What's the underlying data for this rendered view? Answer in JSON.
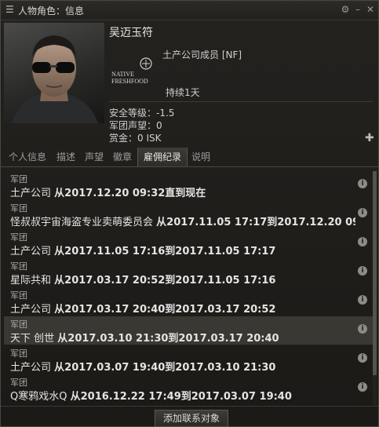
{
  "window": {
    "title": "人物角色：信息",
    "icons": [
      "menu-icon",
      "settings-icon",
      "minimize-icon",
      "close-icon"
    ]
  },
  "character": {
    "name": "吴迈玉符",
    "corp_logo_line1": "NATIVE",
    "corp_logo_line2": "FRESHFOOD",
    "corp_member": "土产公司成员 [NF]",
    "duration": "持续1天",
    "security": "安全等级：-1.5",
    "standing": "军团声望：0",
    "bounty": "赏金：0 ISK"
  },
  "tabs": [
    {
      "label": "个人信息",
      "active": false
    },
    {
      "label": "描述",
      "active": false
    },
    {
      "label": "声望",
      "active": false
    },
    {
      "label": "徽章",
      "active": false
    },
    {
      "label": "雇佣纪录",
      "active": true
    },
    {
      "label": "说明",
      "active": false
    }
  ],
  "employment": [
    {
      "label": "军团",
      "corp": "土产公司",
      "text": "从2017.12.20 09:32直到现在",
      "highlight": false
    },
    {
      "label": "军团",
      "corp": "怪叔叔宇宙海盗专业卖萌委员会",
      "text": "从2017.11.05 17:17到2017.12.20 09:32",
      "highlight": false
    },
    {
      "label": "军团",
      "corp": "土产公司",
      "text": "从2017.11.05 17:16到2017.11.05 17:17",
      "highlight": false
    },
    {
      "label": "军团",
      "corp": "星际共和",
      "text": "从2017.03.17 20:52到2017.11.05 17:16",
      "highlight": false
    },
    {
      "label": "军团",
      "corp": "土产公司",
      "text": "从2017.03.17 20:40到2017.03.17 20:52",
      "highlight": false
    },
    {
      "label": "军团",
      "corp": "天下 创世",
      "text": "从2017.03.10 21:30到2017.03.17 20:40",
      "highlight": true
    },
    {
      "label": "军团",
      "corp": "土产公司",
      "text": "从2017.03.07 19:40到2017.03.10 21:30",
      "highlight": false
    },
    {
      "label": "军团",
      "corp": "Q寒鸦戏水Q",
      "text": "从2016.12.22 17:49到2017.03.07 19:40",
      "highlight": false
    }
  ],
  "footer": {
    "add_contact": "添加联系对象"
  }
}
